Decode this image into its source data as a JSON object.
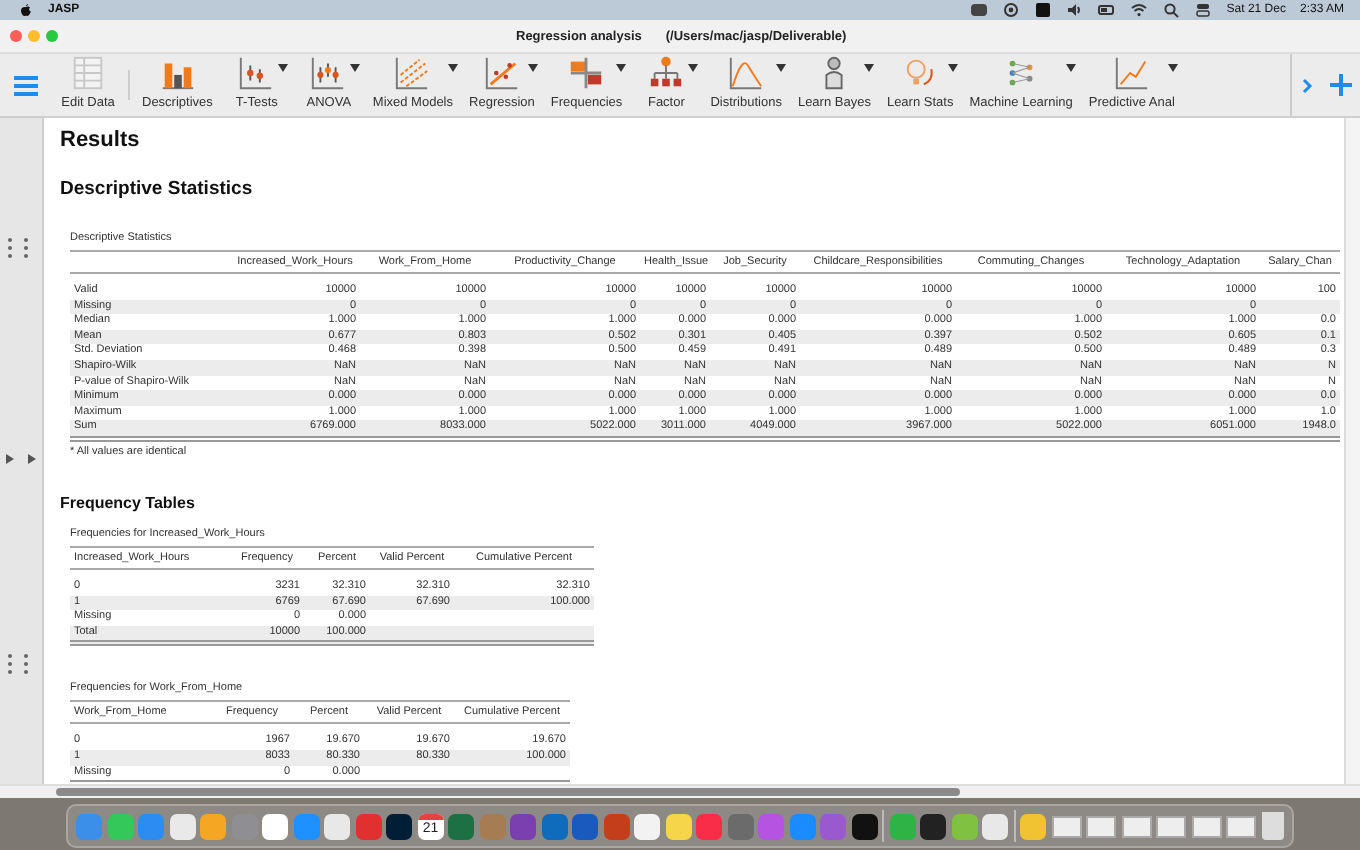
{
  "menubar": {
    "app": "JASP",
    "date": "Sat 21 Dec",
    "time": "2:33 AM"
  },
  "window": {
    "title": "Regression analysis",
    "path": "(/Users/mac/jasp/Deliverable)"
  },
  "toolbar": [
    {
      "label": "Edit Data",
      "menu": false
    },
    {
      "label": "Descriptives",
      "menu": false
    },
    {
      "label": "T-Tests",
      "menu": true
    },
    {
      "label": "ANOVA",
      "menu": true
    },
    {
      "label": "Mixed Models",
      "menu": true
    },
    {
      "label": "Regression",
      "menu": true
    },
    {
      "label": "Frequencies",
      "menu": true
    },
    {
      "label": "Factor",
      "menu": true
    },
    {
      "label": "Distributions",
      "menu": true
    },
    {
      "label": "Learn Bayes",
      "menu": true
    },
    {
      "label": "Learn Stats",
      "menu": true
    },
    {
      "label": "Machine Learning",
      "menu": true
    },
    {
      "label": "Predictive Anal",
      "menu": true
    }
  ],
  "results": {
    "heading": "Results",
    "sections": [
      {
        "heading": "Descriptive Statistics",
        "tables": [
          {
            "title": "Descriptive Statistics",
            "columns": [
              "Increased_Work_Hours",
              "Work_From_Home",
              "Productivity_Change",
              "Health_Issue",
              "Job_Security",
              "Childcare_Responsibilities",
              "Commuting_Changes",
              "Technology_Adaptation",
              "Salary_Chan"
            ],
            "rows": [
              {
                "label": "Valid",
                "cells": [
                  "10000",
                  "10000",
                  "10000",
                  "10000",
                  "10000",
                  "10000",
                  "10000",
                  "10000",
                  "100"
                ]
              },
              {
                "label": "Missing",
                "cells": [
                  "0",
                  "0",
                  "0",
                  "0",
                  "0",
                  "0",
                  "0",
                  "0",
                  null
                ]
              },
              {
                "label": "Median",
                "cells": [
                  "1.000",
                  "1.000",
                  "1.000",
                  "0.000",
                  "0.000",
                  "0.000",
                  "1.000",
                  "1.000",
                  "0.0"
                ]
              },
              {
                "label": "Mean",
                "cells": [
                  "0.677",
                  "0.803",
                  "0.502",
                  "0.301",
                  "0.405",
                  "0.397",
                  "0.502",
                  "0.605",
                  "0.1"
                ]
              },
              {
                "label": "Std. Deviation",
                "cells": [
                  "0.468",
                  "0.398",
                  "0.500",
                  "0.459",
                  "0.491",
                  "0.489",
                  "0.500",
                  "0.489",
                  "0.3"
                ]
              },
              {
                "label": "Shapiro-Wilk",
                "cells": [
                  "NaN",
                  "NaN",
                  "NaN",
                  "NaN",
                  "NaN",
                  "NaN",
                  "NaN",
                  "NaN",
                  "N"
                ]
              },
              {
                "label": "P-value of Shapiro-Wilk",
                "cells": [
                  "NaN",
                  "NaN",
                  "NaN",
                  "NaN",
                  "NaN",
                  "NaN",
                  "NaN",
                  "NaN",
                  "N"
                ]
              },
              {
                "label": "Minimum",
                "cells": [
                  "0.000",
                  "0.000",
                  "0.000",
                  "0.000",
                  "0.000",
                  "0.000",
                  "0.000",
                  "0.000",
                  "0.0"
                ]
              },
              {
                "label": "Maximum",
                "cells": [
                  "1.000",
                  "1.000",
                  "1.000",
                  "1.000",
                  "1.000",
                  "1.000",
                  "1.000",
                  "1.000",
                  "1.0"
                ]
              },
              {
                "label": "Sum",
                "cells": [
                  "6769.000",
                  "8033.000",
                  "5022.000",
                  "3011.000",
                  "4049.000",
                  "3967.000",
                  "5022.000",
                  "6051.000",
                  "1948.0"
                ]
              }
            ],
            "footnote": "* All values are identical"
          }
        ]
      },
      {
        "heading": "Frequency Tables",
        "tables": [
          {
            "title": "Frequencies for Increased_Work_Hours",
            "label_column": "Increased_Work_Hours",
            "columns": [
              "Frequency",
              "Percent",
              "Valid Percent",
              "Cumulative Percent"
            ],
            "rows": [
              {
                "label": "0",
                "cells": [
                  "3231",
                  "32.310",
                  "32.310",
                  "32.310"
                ]
              },
              {
                "label": "1",
                "cells": [
                  "6769",
                  "67.690",
                  "67.690",
                  "100.000"
                ]
              },
              {
                "label": "Missing",
                "cells": [
                  "0",
                  "0.000",
                  null,
                  null
                ]
              },
              {
                "label": "Total",
                "cells": [
                  "10000",
                  "100.000",
                  null,
                  null
                ]
              }
            ]
          },
          {
            "title": "Frequencies for Work_From_Home",
            "label_column": "Work_From_Home",
            "columns": [
              "Frequency",
              "Percent",
              "Valid Percent",
              "Cumulative Percent"
            ],
            "rows": [
              {
                "label": "0",
                "cells": [
                  "1967",
                  "19.670",
                  "19.670",
                  "19.670"
                ]
              },
              {
                "label": "1",
                "cells": [
                  "8033",
                  "80.330",
                  "80.330",
                  "100.000"
                ]
              },
              {
                "label": "Missing",
                "cells": [
                  "0",
                  "0.000",
                  null,
                  null
                ]
              }
            ]
          }
        ]
      }
    ]
  },
  "dock": {
    "calendar_day": "21"
  }
}
